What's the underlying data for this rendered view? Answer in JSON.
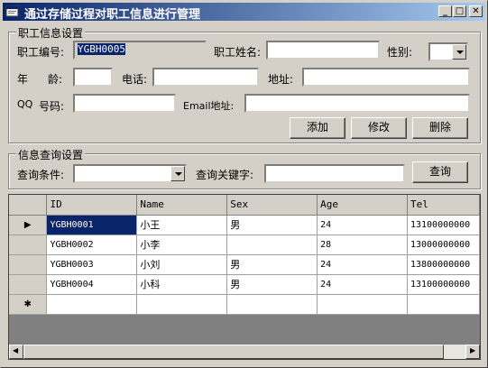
{
  "window": {
    "title": "通过存储过程对职工信息进行管理",
    "minimize_glyph": "_",
    "maximize_glyph": "□",
    "close_glyph": "✕"
  },
  "employee_group": {
    "title": "职工信息设置",
    "id_label": "职工编号:",
    "id_value": "YGBH0005",
    "name_label": "职工姓名:",
    "name_value": "",
    "sex_label": "性别:",
    "sex_value": "",
    "age_label_1": "年",
    "age_label_2": "龄:",
    "age_value": "",
    "phone_label": "电话:",
    "phone_value": "",
    "address_label": "地址:",
    "address_value": "",
    "qq_label_1": "QQ",
    "qq_label_2": "号码:",
    "qq_value": "",
    "email_label": "Email地址:",
    "email_value": "",
    "add_button": "添加",
    "edit_button": "修改",
    "delete_button": "删除"
  },
  "query_group": {
    "title": "信息查询设置",
    "condition_label": "查询条件:",
    "condition_value": "",
    "keyword_label": "查询关键字:",
    "keyword_value": "",
    "query_button": "查询"
  },
  "grid": {
    "columns": [
      "ID",
      "Name",
      "Sex",
      "Age",
      "Tel"
    ],
    "rows": [
      {
        "id": "YGBH0001",
        "name": "小王",
        "sex": "男",
        "age": "24",
        "tel": "13100000000"
      },
      {
        "id": "YGBH0002",
        "name": "小李",
        "sex": "",
        "age": "28",
        "tel": "13000000000"
      },
      {
        "id": "YGBH0003",
        "name": "小刘",
        "sex": "男",
        "age": "24",
        "tel": "13800000000"
      },
      {
        "id": "YGBH0004",
        "name": "小科",
        "sex": "男",
        "age": "24",
        "tel": "13100000000"
      }
    ],
    "current_row_glyph": "▶",
    "new_row_glyph": "✱",
    "scroll_left_glyph": "◀",
    "scroll_right_glyph": "▶"
  }
}
